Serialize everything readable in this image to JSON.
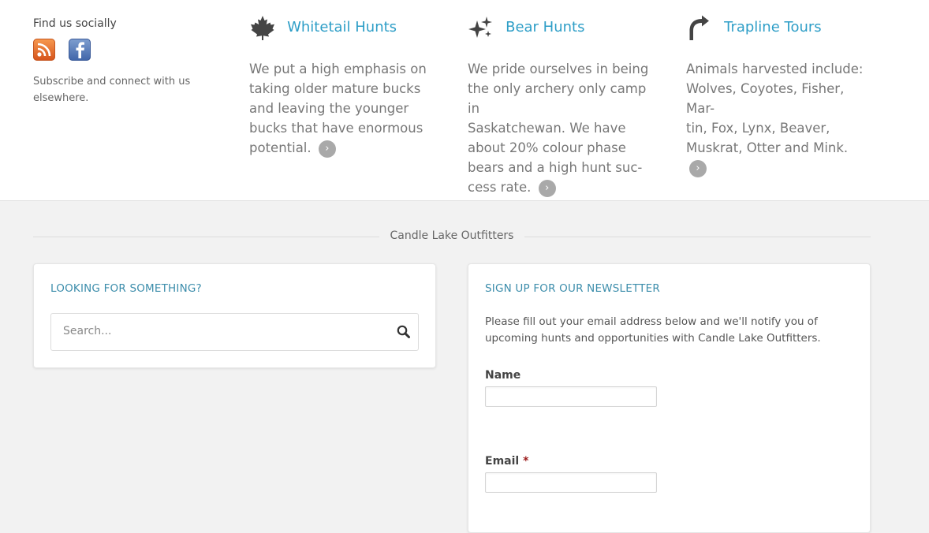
{
  "social": {
    "title": "Find us socially",
    "icons": [
      "rss-icon",
      "facebook-icon"
    ],
    "subtitle": "Subscribe and connect with us elsewhere."
  },
  "features": [
    {
      "icon": "maple-leaf-icon",
      "title": "Whitetail Hunts",
      "lines": [
        "We put a high emphasis on",
        "taking older mature bucks",
        "and leaving the younger",
        "bucks that have enormous",
        "potential."
      ]
    },
    {
      "icon": "sparkles-icon",
      "title": "Bear Hunts",
      "lines": [
        "We pride ourselves in being",
        "the only archery only camp in",
        "Saskatchewan. We have",
        "about 20% colour phase",
        "bears and a high hunt suc-",
        "cess rate."
      ]
    },
    {
      "icon": "curved-arrow-icon",
      "title": "Trapline Tours",
      "lines": [
        "Animals harvested include:",
        "Wolves, Coyotes, Fisher, Mar-",
        "tin, Fox, Lynx, Beaver,",
        "Muskrat, Otter and Mink."
      ]
    }
  ],
  "more_glyph": "›",
  "footer": {
    "divider_label": "Candle Lake Outfitters",
    "search": {
      "heading": "LOOKING FOR SOMETHING?",
      "placeholder": "Search...",
      "icon": "search-icon"
    },
    "newsletter": {
      "heading": "SIGN UP FOR OUR NEWSLETTER",
      "description_lines": [
        "Please fill out your email address below and we'll notify you of",
        "upcoming hunts and opportunities with Candle Lake Outfitters."
      ],
      "name_label": "Name",
      "email_label": "Email",
      "required_mark": "*"
    }
  },
  "colors": {
    "link": "#2e9ec7",
    "heading": "#3c8dab",
    "required": "#9b1b1b",
    "footer_bg": "#f2f2f2"
  }
}
